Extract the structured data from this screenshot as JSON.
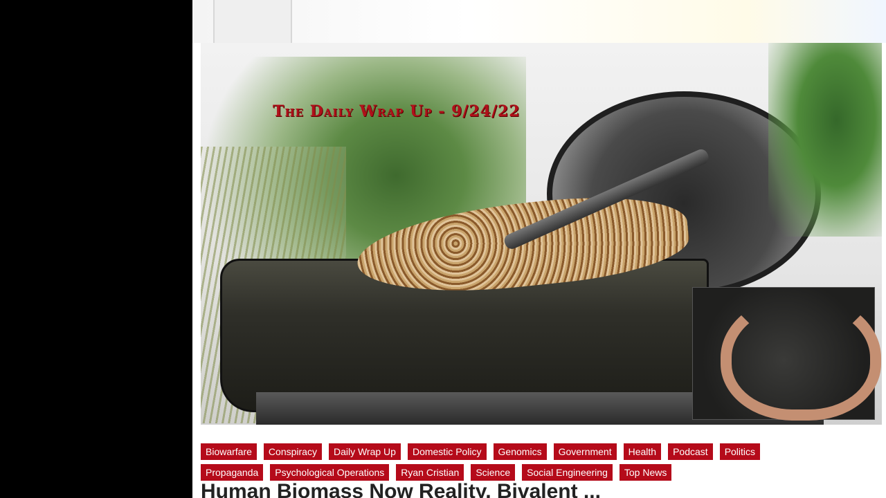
{
  "article": {
    "image_title_overlay": "The Daily Wrap Up - 9/24/22",
    "headline": "Human Biomass Now Reality, Bivalent ..."
  },
  "tags_row1": [
    "Biowarfare",
    "Conspiracy",
    "Daily Wrap Up",
    "Domestic Policy",
    "Genomics",
    "Government",
    "Health",
    "Podcast",
    "Politics"
  ],
  "tags_row2": [
    "Propaganda",
    "Psychological Operations",
    "Ryan Cristian",
    "Science",
    "Social Engineering",
    "Top News"
  ],
  "colors": {
    "tag_bg": "#b50b1a",
    "overlay_text": "#b0101a"
  }
}
